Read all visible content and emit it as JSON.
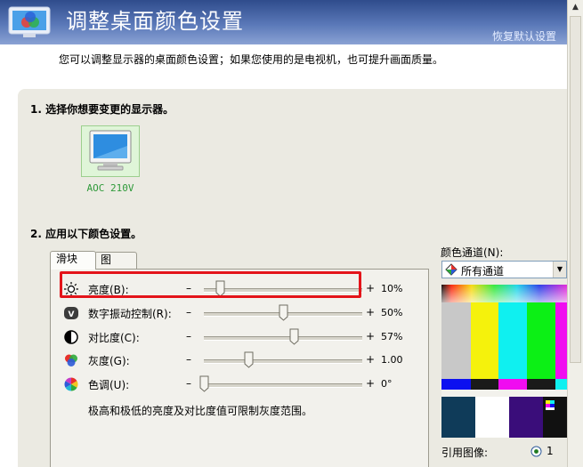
{
  "header": {
    "title": "调整桌面颜色设置",
    "restore_link": "恢复默认设置"
  },
  "description": "您可以调整显示器的桌面颜色设置；如果您使用的是电视机，也可提升画面质量。",
  "step1": {
    "label": "1. 选择你想要变更的显示器。",
    "monitor_name": "AOC 210V"
  },
  "step2": {
    "label": "2. 应用以下颜色设置。",
    "tabs": [
      "滑块",
      "图"
    ],
    "minus_sign": "–",
    "plus_sign": "+",
    "sliders": [
      {
        "label": "亮度(B):",
        "value_text": "10%",
        "level": 0.1
      },
      {
        "label": "数字振动控制(R):",
        "value_text": "50%",
        "level": 0.5
      },
      {
        "label": "对比度(C):",
        "value_text": "57%",
        "level": 0.57
      },
      {
        "label": "灰度(G):",
        "value_text": "1.00",
        "level": 0.28
      },
      {
        "label": "色调(U):",
        "value_text": "0°",
        "level": 0.0
      }
    ],
    "hint": "极高和极低的亮度及对比度值可限制灰度范围。"
  },
  "channel": {
    "label": "颜色通道(N):",
    "selected": "所有通道"
  },
  "reference": {
    "label": "引用图像:",
    "option": "1"
  },
  "icons": {
    "header": "display-color-icon",
    "brightness": "sun-icon",
    "vibrance": "vibrance-icon",
    "contrast": "contrast-icon",
    "gamma": "color-dots-icon",
    "hue": "color-wheel-icon"
  },
  "colors": {
    "header_blue": "#3a5799",
    "highlight_red": "#e4141a",
    "monitor_label_green": "#2f9a3a",
    "panel_bg": "#ebeae2"
  }
}
